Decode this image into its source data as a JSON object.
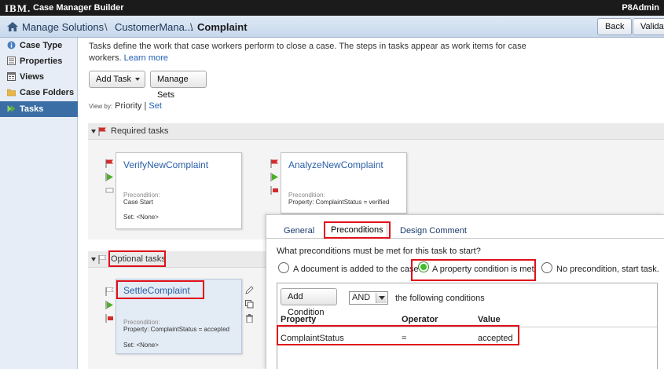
{
  "topbar": {
    "logo": "IBM.",
    "app_title": "Case Manager Builder",
    "user": "P8Admin"
  },
  "breadcrumb": {
    "items": [
      "Manage Solutions",
      "CustomerMana...",
      "Complaint"
    ],
    "separator": "\\"
  },
  "header_buttons": {
    "back": "Back",
    "validate": "Validate"
  },
  "sidebar": {
    "items": [
      {
        "label": "Case Type",
        "icon": "info-circle-icon"
      },
      {
        "label": "Properties",
        "icon": "properties-list-icon"
      },
      {
        "label": "Views",
        "icon": "views-grid-icon"
      },
      {
        "label": "Case Folders",
        "icon": "folder-icon"
      },
      {
        "label": "Tasks",
        "icon": "tasks-icon",
        "active": true
      }
    ]
  },
  "main": {
    "intro_text": "Tasks define the work that case workers perform to close a case. The steps in tasks appear as work items for case workers.",
    "learn_more": "Learn more",
    "add_task": "Add Task",
    "manage_sets": "Manage Sets",
    "view_by_label": "View by:",
    "view_by_priority": "Priority",
    "view_by_sep": "|",
    "view_by_set": "Set"
  },
  "sections": {
    "required": {
      "label": "Required tasks"
    },
    "optional": {
      "label": "Optional tasks"
    }
  },
  "tasks": [
    {
      "title": "VerifyNewComplaint",
      "precondition_label": "Precondition:",
      "precondition": "Case Start",
      "set": "Set: <None>"
    },
    {
      "title": "AnalyzeNewComplaint",
      "precondition_label": "Precondition:",
      "precondition": "Property: ComplaintStatus = verified"
    },
    {
      "title": "SettleComplaint",
      "precondition_label": "Precondition:",
      "precondition": "Property: ComplaintStatus = accepted",
      "set": "Set: <None>"
    }
  ],
  "panel": {
    "tabs": [
      "General",
      "Preconditions",
      "Design Comment"
    ],
    "active_tab": "Preconditions",
    "question": "What preconditions must be met for this task to start?",
    "options": [
      {
        "label": "A document is added to the case",
        "checked": false
      },
      {
        "label": "A property condition is met",
        "checked": true
      },
      {
        "label": "No precondition, start task.",
        "checked": false
      }
    ],
    "add_condition": "Add Condition",
    "logic": "AND",
    "following": "the following conditions",
    "columns": [
      "Property",
      "Operator",
      "Value"
    ],
    "rows": [
      {
        "property": "ComplaintStatus",
        "operator": "=",
        "value": "accepted"
      }
    ]
  },
  "colors": {
    "topbar": "#1b1b1b",
    "sidebar_active": "#3a6ea5",
    "link": "#2a5fa7",
    "highlight": "#e0101a",
    "radio_checked": "#3fbf2a"
  }
}
